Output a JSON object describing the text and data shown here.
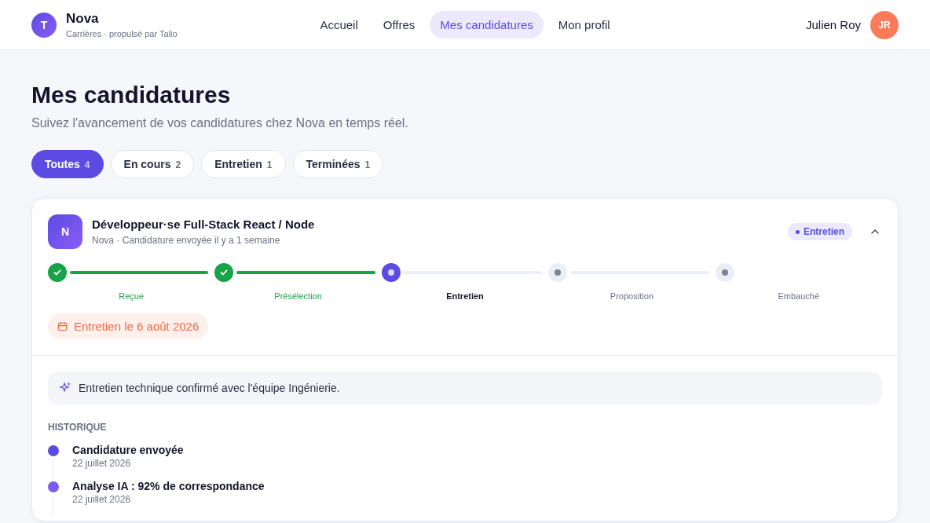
{
  "brand": {
    "initial": "T",
    "name": "Nova",
    "tagline": "Carrières · propulsé par Talio"
  },
  "nav": [
    {
      "label": "Accueil",
      "selected": false
    },
    {
      "label": "Offres",
      "selected": false
    },
    {
      "label": "Mes candidatures",
      "selected": true
    },
    {
      "label": "Mon profil",
      "selected": false
    }
  ],
  "user": {
    "name": "Julien Roy",
    "initials": "JR"
  },
  "page": {
    "title": "Mes candidatures",
    "subtitle": "Suivez l'avancement de vos candidatures chez Nova en temps réel."
  },
  "filters": [
    {
      "label": "Toutes",
      "count": "4",
      "selected": true
    },
    {
      "label": "En cours",
      "count": "2",
      "selected": false
    },
    {
      "label": "Entretien",
      "count": "1",
      "selected": false
    },
    {
      "label": "Terminées",
      "count": "1",
      "selected": false
    }
  ],
  "application": {
    "logo": "N",
    "title": "Développeur·se Full-Stack React / Node",
    "meta": "Nova · Candidature envoyée il y a 1 semaine",
    "status": "Entretien",
    "expanded": true,
    "steps": [
      {
        "label": "Reçue",
        "completed": true,
        "selected": false
      },
      {
        "label": "Présélection",
        "completed": true,
        "selected": false
      },
      {
        "label": "Entretien",
        "completed": false,
        "selected": true
      },
      {
        "label": "Proposition",
        "completed": false,
        "selected": false
      },
      {
        "label": "Embauché",
        "completed": false,
        "selected": false
      }
    ],
    "event": "Entretien le 6 août 2026",
    "note": "Entretien technique confirmé avec l'équipe Ingénierie.",
    "history_title": "HISTORIQUE",
    "history": [
      {
        "title": "Candidature envoyée",
        "date": "22 juillet 2026",
        "color": "#5b4be2"
      },
      {
        "title": "Analyse IA : 92% de correspondance",
        "date": "22 juillet 2026",
        "color": "#7b5cf0"
      }
    ]
  }
}
